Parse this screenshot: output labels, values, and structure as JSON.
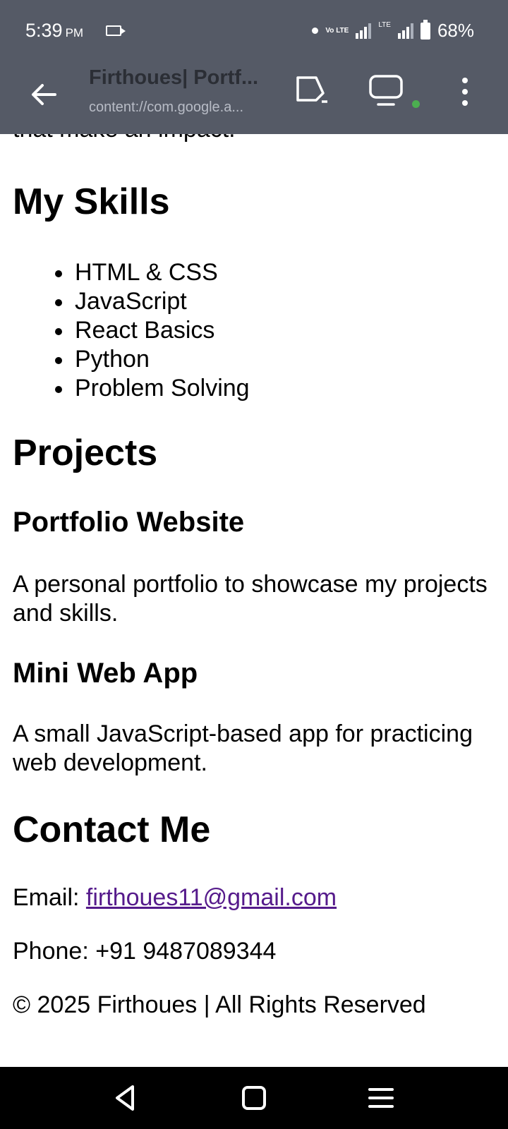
{
  "status_bar": {
    "time": "5:39",
    "ampm": "PM",
    "network_label": "Vo LTE",
    "lte_label": "LTE",
    "battery": "68%"
  },
  "toolbar": {
    "title": "Firthoues| Portf...",
    "url": "content://com.google.a..."
  },
  "page": {
    "cut_text": "that make an impact.",
    "skills_heading": "My Skills",
    "skills": [
      "HTML & CSS",
      "JavaScript",
      "React Basics",
      "Python",
      "Problem Solving"
    ],
    "projects_heading": "Projects",
    "projects": [
      {
        "title": "Portfolio Website",
        "description": "A personal portfolio to showcase my projects and skills."
      },
      {
        "title": "Mini Web App",
        "description": "A small JavaScript-based app for practicing web development."
      }
    ],
    "contact_heading": "Contact Me",
    "email_label": "Email: ",
    "email": "firthoues11@gmail.com",
    "phone": "Phone: +91 9487089344",
    "footer": "© 2025 Firthoues | All Rights Reserved"
  },
  "icons": {
    "back": "arrow-back-icon",
    "share": "share-icon",
    "devices": "devices-icon",
    "more": "more-vert-icon",
    "nav_back": "nav-back-icon",
    "nav_home": "nav-home-icon",
    "nav_menu": "nav-menu-icon"
  },
  "colors": {
    "toolbar_bg": "#555a66",
    "link": "#551a8b",
    "live_dot": "#4caf50"
  }
}
